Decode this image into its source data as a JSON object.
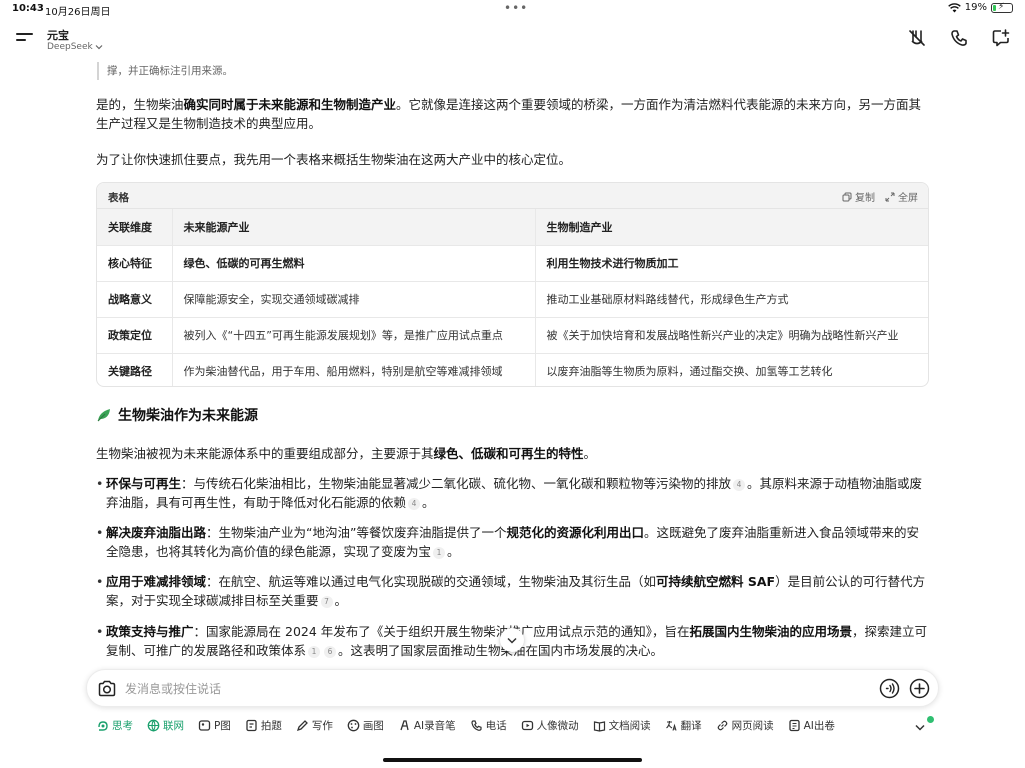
{
  "status_bar": {
    "time": "10:43",
    "date": "10月26日周日",
    "battery_pct": "19%",
    "battery_level": 0.19
  },
  "header": {
    "app_name": "元宝",
    "model": "DeepSeek"
  },
  "content": {
    "quote_tail": "撑，并正确标注引用来源。",
    "intro_p1": {
      "a": "是的，生物柴油",
      "b": "确实同时属于未来能源和生物制造产业",
      "c": "。它就像是连接这两个重要领域的桥梁，一方面作为清洁燃料代表能源的未来方向，另一方面其生产过程又是生物制造技术的典型应用。"
    },
    "intro_p2": "为了让你快速抓住要点，我先用一个表格来概括生物柴油在这两大产业中的核心定位。",
    "table": {
      "label": "表格",
      "copy": "复制",
      "fullscreen": "全屏",
      "headers": [
        "关联维度",
        "未来能源产业",
        "生物制造产业"
      ],
      "rows": [
        [
          "核心特征",
          "绿色、低碳的可再生燃料",
          "利用生物技术进行物质加工"
        ],
        [
          "战略意义",
          "保障能源安全，实现交通领域碳减排",
          "推动工业基础原材料路线替代，形成绿色生产方式"
        ],
        [
          "政策定位",
          "被列入《“十四五”可再生能源发展规划》等，是推广应用试点重点",
          "被《关于加快培育和发展战略性新兴产业的决定》明确为战略性新兴产业"
        ],
        [
          "关键路径",
          "作为柴油替代品，用于车用、船用燃料，特别是航空等难减排领域",
          "以废弃油脂等生物质为原料，通过酯交换、加氢等工艺转化"
        ]
      ]
    },
    "section_title": "生物柴油作为未来能源",
    "section_intro": {
      "a": "生物柴油被视为未来能源体系中的重要组成部分，主要源于其",
      "b": "绿色、低碳和可再生的特性",
      "c": "。"
    },
    "bullets": [
      {
        "head": "环保与可再生",
        "t1": "：与传统石化柴油相比，生物柴油能显著减少二氧化碳、硫化物、一氧化碳和颗粒物等污染物的排放",
        "r1": "4",
        "t2": "。其原料来源于动植物油脂或废弃油脂，具有可再生性，有助于降低对化石能源的依赖",
        "r2": "4",
        "t3": "。"
      },
      {
        "head": "解决废弃油脂出路",
        "t1": "：生物柴油产业为“地沟油”等餐饮废弃油脂提供了一个",
        "b1": "规范化的资源化利用出口",
        "t2": "。这既避免了废弃油脂重新进入食品领域带来的安全隐患，也将其转化为高价值的绿色能源，实现了变废为宝",
        "r1": "1",
        "t3": "。"
      },
      {
        "head": "应用于难减排领域",
        "t1": "：在航空、航运等难以通过电气化实现脱碳的交通领域，生物柴油及其衍生品（如",
        "b1": "可持续航空燃料 SAF",
        "t2": "）是目前公认的可行替代方案，对于实现全球碳减排目标至关重要",
        "r1": "7",
        "t3": "。"
      },
      {
        "head": "政策支持与推广",
        "t1": "：国家能源局在 2024 年发布了《关于组织开展生物柴油推广应用试点示范的通知》，旨在",
        "b1": "拓展国内生物柴油的应用场景",
        "t2": "，探索建立可复制、可推广的发展路径和政策体系",
        "r1": "1",
        "r2": "6",
        "t3": "。这表明了国家层面推动生物柴油在国内市场发展的决心。"
      }
    ]
  },
  "input": {
    "placeholder": "发消息或按住说话"
  },
  "tools": [
    {
      "label": "思考",
      "icon": "deep-think-icon",
      "active": true
    },
    {
      "label": "联网",
      "icon": "globe-icon",
      "active": true
    },
    {
      "label": "P图",
      "icon": "image-edit-icon",
      "active": false
    },
    {
      "label": "拍题",
      "icon": "scan-question-icon",
      "active": false
    },
    {
      "label": "写作",
      "icon": "pen-icon",
      "active": false
    },
    {
      "label": "画图",
      "icon": "palette-icon",
      "active": false
    },
    {
      "label": "AI录音笔",
      "icon": "recorder-icon",
      "active": false
    },
    {
      "label": "电话",
      "icon": "phone-icon",
      "active": false
    },
    {
      "label": "人像微动",
      "icon": "portrait-motion-icon",
      "active": false
    },
    {
      "label": "文档阅读",
      "icon": "book-icon",
      "active": false
    },
    {
      "label": "翻译",
      "icon": "translate-icon",
      "active": false
    },
    {
      "label": "网页阅读",
      "icon": "link-icon",
      "active": false
    },
    {
      "label": "AI出卷",
      "icon": "exam-paper-icon",
      "active": false
    }
  ],
  "colors": {
    "accent": "#1aa06d",
    "badge": "#2fbf71"
  }
}
